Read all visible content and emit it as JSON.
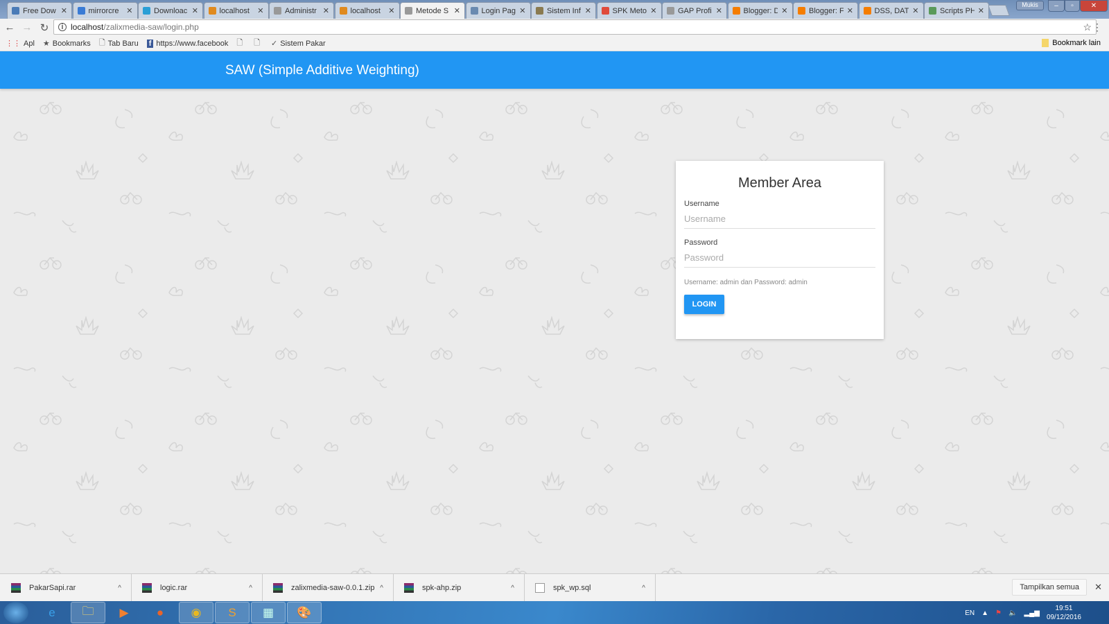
{
  "browser": {
    "tabs": [
      {
        "title": "Free Dow",
        "icon": "loading-icon",
        "color": "#4a7bb7"
      },
      {
        "title": "mirrorcre",
        "icon": "link-icon",
        "color": "#3a7bd5"
      },
      {
        "title": "Downloac",
        "icon": "globe-icon",
        "color": "#2a9fd6"
      },
      {
        "title": "localhost",
        "icon": "pma-icon",
        "color": "#e08a1e"
      },
      {
        "title": "Administr",
        "icon": "page-icon",
        "color": "#999999"
      },
      {
        "title": "localhost",
        "icon": "pma-icon",
        "color": "#e08a1e"
      },
      {
        "title": "Metode S",
        "icon": "page-icon",
        "color": "#999999",
        "active": true
      },
      {
        "title": "Login Pag",
        "icon": "user-icon",
        "color": "#6a8ab0"
      },
      {
        "title": "Sistem Inf",
        "icon": "user-icon",
        "color": "#8a7a50"
      },
      {
        "title": "SPK Meto",
        "icon": "pinwheel-icon",
        "color": "#e04a3a"
      },
      {
        "title": "GAP Profi",
        "icon": "page-icon",
        "color": "#999999"
      },
      {
        "title": "Blogger: D",
        "icon": "blogger-icon",
        "color": "#f57d00"
      },
      {
        "title": "Blogger: F",
        "icon": "blogger-icon",
        "color": "#f57d00"
      },
      {
        "title": "DSS, DAT",
        "icon": "blogger-icon",
        "color": "#f57d00"
      },
      {
        "title": "Scripts PH",
        "icon": "check-icon",
        "color": "#5a9a5a"
      }
    ],
    "user": "Mukis",
    "url_host": "localhost",
    "url_path": "/zalixmedia-saw/login.php",
    "bookmarks": [
      {
        "label": "Apl",
        "icon": "apps-icon"
      },
      {
        "label": "Bookmarks",
        "icon": "star-icon"
      },
      {
        "label": "Tab Baru",
        "icon": "page-icon"
      },
      {
        "label": "https://www.facebook",
        "icon": "facebook-icon"
      },
      {
        "label": "",
        "icon": "page-icon"
      },
      {
        "label": "",
        "icon": "page-icon"
      },
      {
        "label": "Sistem Pakar",
        "icon": "check-icon"
      }
    ],
    "other_bookmarks": "Bookmark lain"
  },
  "page": {
    "header_title": "SAW (Simple Additive Weighting)",
    "header_color": "#2196f3",
    "login": {
      "title": "Member Area",
      "username_label": "Username",
      "username_placeholder": "Username",
      "username_value": "",
      "password_label": "Password",
      "password_placeholder": "Password",
      "password_value": "",
      "hint": "Username: admin dan Password: admin",
      "button": "LOGIN"
    }
  },
  "downloads": {
    "items": [
      "PakarSapi.rar",
      "logic.rar",
      "zalixmedia-saw-0.0.1.zip",
      "spk-ahp.zip",
      "spk_wp.sql"
    ],
    "show_all": "Tampilkan semua"
  },
  "taskbar": {
    "apps": [
      "internet-explorer-icon",
      "file-explorer-icon",
      "media-player-icon",
      "firefox-icon",
      "chrome-icon",
      "sublime-text-icon",
      "control-panel-icon",
      "paint-icon"
    ],
    "lang": "EN",
    "time": "19:51",
    "date": "09/12/2016"
  }
}
